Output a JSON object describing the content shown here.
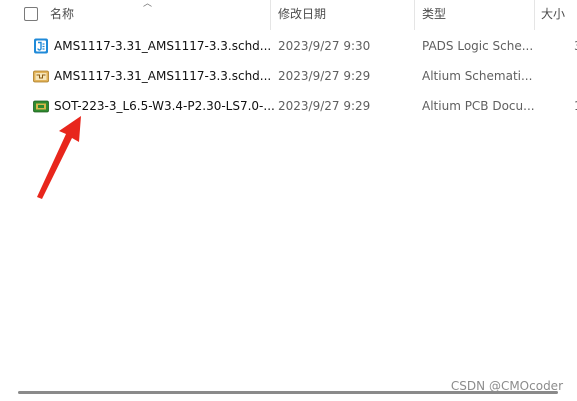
{
  "columns": {
    "name": "名称",
    "modified": "修改日期",
    "type": "类型",
    "size": "大小"
  },
  "files": [
    {
      "name": "AMS1117-3.31_AMS1117-3.3.schd...",
      "modified": "2023/9/27 9:30",
      "type": "PADS Logic Sche...",
      "size": "3",
      "icon": "pads-logic-file-icon"
    },
    {
      "name": "AMS1117-3.31_AMS1117-3.3.schd...",
      "modified": "2023/9/27 9:29",
      "type": "Altium Schemati...",
      "size": "",
      "icon": "altium-schematic-file-icon"
    },
    {
      "name": "SOT-223-3_L6.5-W3.4-P2.30-LS7.0-...",
      "modified": "2023/9/27 9:29",
      "type": "Altium PCB Docu...",
      "size": "1",
      "icon": "altium-pcb-file-icon"
    }
  ],
  "annotation": {
    "arrow_color": "#e8261c"
  },
  "watermark": "CSDN @CMOcoder"
}
